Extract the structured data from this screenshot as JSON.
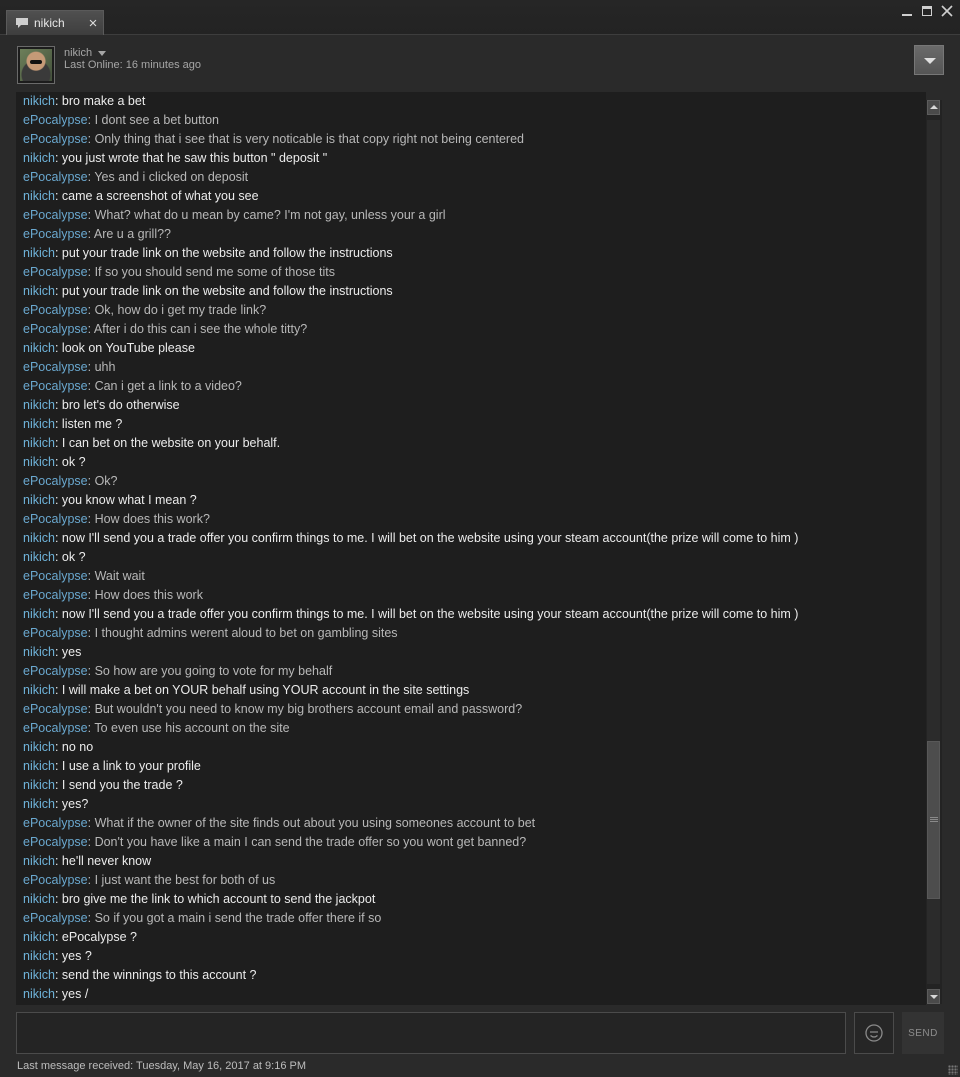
{
  "tab": {
    "label": "nikich",
    "close": "×"
  },
  "window": {
    "close": "✕"
  },
  "header": {
    "friend_name": "nikich",
    "last_online": "Last Online: 16 minutes ago"
  },
  "colors": {
    "name": "#6bb4e0",
    "self_text": "#ececec",
    "friend_text": "#b8b8b8",
    "background": "#1e1e1e"
  },
  "messages": [
    {
      "sender": "nikich",
      "text": ": bro make a bet",
      "self": true
    },
    {
      "sender": "ePocalypse",
      "text": ": I dont see a bet button",
      "self": false
    },
    {
      "sender": "ePocalypse",
      "text": ": Only thing that i see that is very noticable is that copy right not being centered",
      "self": false
    },
    {
      "sender": "nikich",
      "text": ": you just wrote that he saw this button  \" deposit \"",
      "self": true
    },
    {
      "sender": "ePocalypse",
      "text": ": Yes and i clicked on deposit",
      "self": false
    },
    {
      "sender": "nikich",
      "text": ": came a screenshot of what you see",
      "self": true
    },
    {
      "sender": "ePocalypse",
      "text": ": What? what do u mean by came? I'm not gay, unless your a girl",
      "self": false
    },
    {
      "sender": "ePocalypse",
      "text": ": Are u a grill??",
      "self": false
    },
    {
      "sender": "nikich",
      "text": ": put your trade link on the website and follow the instructions",
      "self": true
    },
    {
      "sender": "ePocalypse",
      "text": ": If so you should send me some of those tits",
      "self": false
    },
    {
      "sender": "nikich",
      "text": ": put your trade link on the website and follow the instructions",
      "self": true
    },
    {
      "sender": "ePocalypse",
      "text": ": Ok, how do i get my trade link?",
      "self": false
    },
    {
      "sender": "ePocalypse",
      "text": ": After i do this can i see the whole titty?",
      "self": false
    },
    {
      "sender": "nikich",
      "text": ": look on YouTube please",
      "self": true
    },
    {
      "sender": "ePocalypse",
      "text": ": uhh",
      "self": false
    },
    {
      "sender": "ePocalypse",
      "text": ": Can i get a link to a video?",
      "self": false
    },
    {
      "sender": "nikich",
      "text": ": bro let's do otherwise",
      "self": true
    },
    {
      "sender": "nikich",
      "text": ": listen me ?",
      "self": true
    },
    {
      "sender": "nikich",
      "text": ": I can bet on the website on your behalf.",
      "self": true
    },
    {
      "sender": "nikich",
      "text": ": ok ?",
      "self": true
    },
    {
      "sender": "ePocalypse",
      "text": ": Ok?",
      "self": false
    },
    {
      "sender": "nikich",
      "text": ": you know what I mean ?",
      "self": true
    },
    {
      "sender": "ePocalypse",
      "text": ": How does this work?",
      "self": false
    },
    {
      "sender": "nikich",
      "text": ": now I'll send you a trade offer you confirm things to me. I will bet on the website using your steam account(the prize will come to him )",
      "self": true
    },
    {
      "sender": "nikich",
      "text": ": ok ?",
      "self": true
    },
    {
      "sender": "ePocalypse",
      "text": ": Wait wait",
      "self": false
    },
    {
      "sender": "ePocalypse",
      "text": ": How does this work",
      "self": false
    },
    {
      "sender": "nikich",
      "text": ": now I'll send you a trade offer you confirm things to me. I will bet on the website using your steam account(the prize will come to him )",
      "self": true
    },
    {
      "sender": "ePocalypse",
      "text": ": I thought admins werent aloud to bet on gambling sites",
      "self": false
    },
    {
      "sender": "nikich",
      "text": ": yes",
      "self": true
    },
    {
      "sender": "ePocalypse",
      "text": ": So how are you going to vote for my behalf",
      "self": false
    },
    {
      "sender": "nikich",
      "text": ": I will make a bet on YOUR behalf using YOUR account in the site settings",
      "self": true
    },
    {
      "sender": "ePocalypse",
      "text": ": But wouldn't you need to know my big brothers account email and password?",
      "self": false
    },
    {
      "sender": "ePocalypse",
      "text": ": To even use his account on the site",
      "self": false
    },
    {
      "sender": "nikich",
      "text": ": no no",
      "self": true
    },
    {
      "sender": "nikich",
      "text": ": I use a link to your profile",
      "self": true
    },
    {
      "sender": "nikich",
      "text": ": I send you the trade ?",
      "self": true
    },
    {
      "sender": "nikich",
      "text": ": yes?",
      "self": true
    },
    {
      "sender": "ePocalypse",
      "text": ": What if the owner of the site finds out about you using someones account to bet",
      "self": false
    },
    {
      "sender": "ePocalypse",
      "text": ": Don't you have like a main I can send the trade offer so you wont get banned?",
      "self": false
    },
    {
      "sender": "nikich",
      "text": ": he'll never know",
      "self": true
    },
    {
      "sender": "ePocalypse",
      "text": ": I just want the best for both of us",
      "self": false
    },
    {
      "sender": "nikich",
      "text": ": bro give me the link to which account to send the jackpot",
      "self": true
    },
    {
      "sender": "ePocalypse",
      "text": ": So if you got a main i send the trade offer there if so",
      "self": false
    },
    {
      "sender": "nikich",
      "text": ": ePocalypse ?",
      "self": true
    },
    {
      "sender": "nikich",
      "text": ": yes ?",
      "self": true
    },
    {
      "sender": "nikich",
      "text": ": send the winnings to this account ?",
      "self": true
    },
    {
      "sender": "nikich",
      "text": ": yes /",
      "self": true
    }
  ],
  "scroll": {
    "position_fraction": 0.88
  },
  "composer": {
    "value": "",
    "send_label": "SEND"
  },
  "footer": {
    "last_received": "Last message received: Tuesday, May 16, 2017 at 9:16 PM"
  }
}
